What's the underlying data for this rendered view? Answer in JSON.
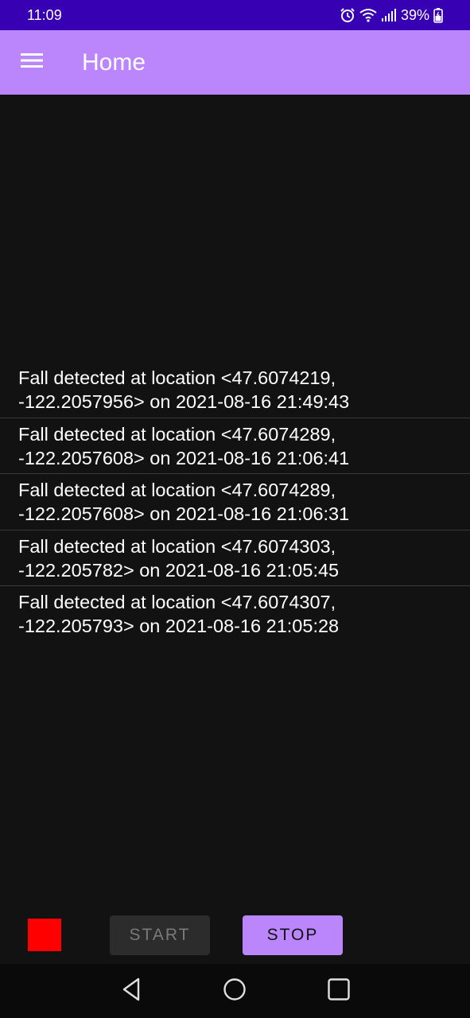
{
  "status_bar": {
    "time": "11:09",
    "battery": "39%",
    "icons": [
      "alarm-icon",
      "wifi-icon",
      "signal-icon",
      "battery-icon"
    ]
  },
  "app_bar": {
    "menu_icon": "hamburger-menu-icon",
    "title": "Home"
  },
  "events": [
    {
      "line1": "Fall detected at location <47.6074219,",
      "line2": "-122.2057956> on 2021-08-16 21:49:43"
    },
    {
      "line1": "Fall detected at location <47.6074289,",
      "line2": "-122.2057608> on 2021-08-16 21:06:41"
    },
    {
      "line1": "Fall detected at location <47.6074289,",
      "line2": "-122.2057608> on 2021-08-16 21:06:31"
    },
    {
      "line1": "Fall detected at location <47.6074303,",
      "line2": "-122.205782> on 2021-08-16 21:05:45"
    },
    {
      "line1": "Fall detected at location <47.6074307,",
      "line2": "-122.205793> on 2021-08-16 21:05:28"
    }
  ],
  "controls": {
    "indicator_color": "#ff0000",
    "start_label": "START",
    "stop_label": "STOP"
  },
  "nav_bar": {
    "icons": [
      "back-icon",
      "home-icon",
      "recents-icon"
    ]
  },
  "colors": {
    "status_bar": "#3700b3",
    "app_bar": "#bb86fc",
    "background": "#121212",
    "accent": "#bb86fc"
  }
}
